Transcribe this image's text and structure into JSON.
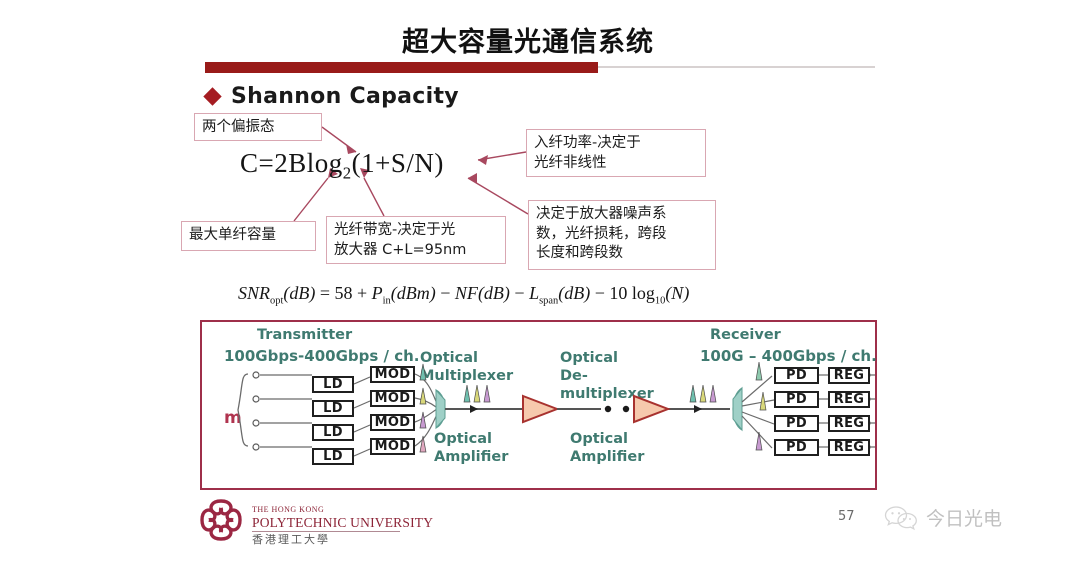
{
  "slide": {
    "title": "超大容量光通信系统",
    "page_number": "57",
    "heading": "Shannon Capacity",
    "accent_red": "#991b19",
    "diamond_red": "#a51c22",
    "callout_border": "#d9a7b2",
    "diagram_border": "#9e2f4a",
    "teal_label": "#3f7a70"
  },
  "callouts": {
    "polarization": "两个偏振态",
    "max_capacity": "最大单纤容量",
    "bandwidth": "光纤带宽-决定于光\n放大器 C+L=95nm",
    "input_power": "入纤功率-决定于\n光纤非线性",
    "noise": "决定于放大器噪声系\n数，光纤损耗，跨段\n长度和跨段数"
  },
  "formulas": {
    "capacity_html": "C=2Blog",
    "capacity_sub": "2",
    "capacity_tail": "(1+S/N)",
    "snr_parts": {
      "snr": "SNR",
      "snr_sub": "opt",
      "db1": "(dB)",
      "eq": "= 58 +",
      "pin": "P",
      "pin_sub": "in",
      "dbm": "(dBm)",
      "minus1": "−",
      "nf": "NF",
      "db2": "(dB)",
      "minus2": "−",
      "lspan": "L",
      "lspan_sub": "span",
      "db3": "(dB)",
      "minus3": "− 10 log",
      "log_sub": "10",
      "n": "(N)"
    }
  },
  "diagram": {
    "transmitter_label": "Transmitter",
    "receiver_label": "Receiver",
    "tx_rate": "100Gbps-400Gbps / ch.",
    "rx_rate": "100G – 400Gbps / ch.",
    "multiplexer": "Optical\nMultiplexer",
    "demultiplexer": "Optical\nDe-multiplexer",
    "amplifier_left": "Optical\nAmplifier",
    "amplifier_right": "Optical\nAmplifier",
    "channel_count_label": "m",
    "tx_rows": [
      {
        "source": "LD",
        "modulator": "MOD"
      },
      {
        "source": "LD",
        "modulator": "MOD"
      },
      {
        "source": "LD",
        "modulator": "MOD"
      },
      {
        "source": "LD",
        "modulator": "MOD"
      }
    ],
    "rx_rows": [
      {
        "detector": "PD",
        "regenerator": "REG"
      },
      {
        "detector": "PD",
        "regenerator": "REG"
      },
      {
        "detector": "PD",
        "regenerator": "REG"
      },
      {
        "detector": "PD",
        "regenerator": "REG"
      }
    ],
    "wavelength_colors": [
      "#6fbfae",
      "#d8d77a",
      "#c79ad0",
      "#e0a8bf"
    ]
  },
  "footer": {
    "university_line1": "THE HONG KONG",
    "university_line2": "POLYTECHNIC UNIVERSITY",
    "university_line3": "香港理工大學"
  },
  "watermark": {
    "text": "今日光电",
    "icon": "wechat-icon"
  }
}
